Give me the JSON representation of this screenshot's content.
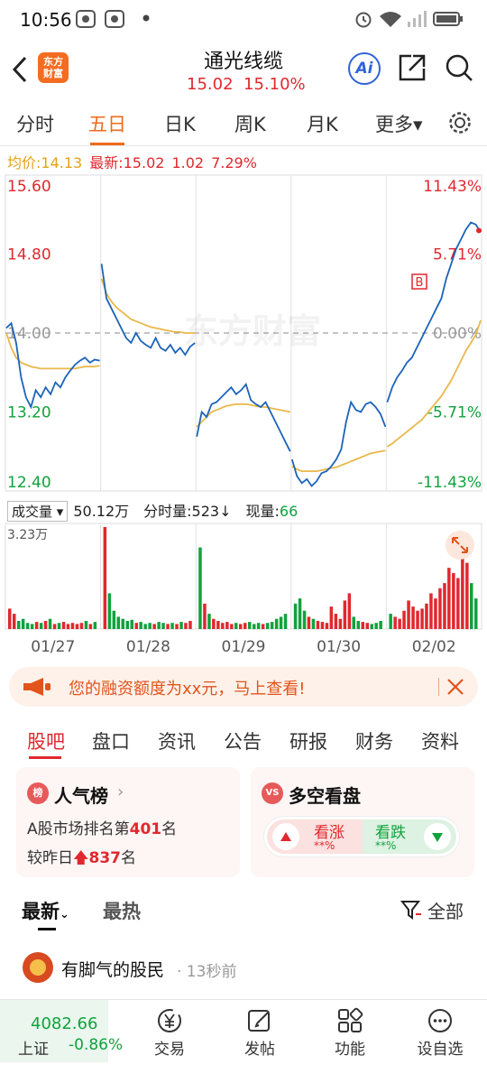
{
  "status": {
    "time": "10:56"
  },
  "header": {
    "logo_text_1": "东方",
    "logo_text_2": "财富",
    "title": "通光线缆",
    "price": "15.02",
    "change_pct": "15.10%",
    "ai_label": "Ai"
  },
  "period_tabs": [
    "分时",
    "五日",
    "日K",
    "周K",
    "月K",
    "更多▾"
  ],
  "avg_line": {
    "avg_label": "均价:",
    "avg_value": "14.13",
    "latest_label": "最新:",
    "latest_value": "15.02",
    "change": "1.02",
    "pct": "7.29%"
  },
  "colors": {
    "up": "#e0282e",
    "down": "#11a23c",
    "avg": "#e9b84a",
    "price": "#1c63b8",
    "accent": "#f06a1b"
  },
  "chart_data": {
    "type": "line",
    "price_axis": [
      "15.60",
      "14.80",
      "14.00",
      "13.20",
      "12.40"
    ],
    "pct_axis": [
      "11.43%",
      "5.71%",
      "0.00%",
      "-5.71%",
      "-11.43%"
    ],
    "days": [
      "01/27",
      "01/28",
      "01/29",
      "01/30",
      "02/02"
    ],
    "ylim": [
      12.4,
      15.6
    ],
    "prev_close": 14.0,
    "watermark": "东方财富",
    "price_series": [
      [
        14.05,
        14.1,
        13.9,
        13.55,
        13.35,
        13.25,
        13.42,
        13.35,
        13.45,
        13.38,
        13.5,
        13.45,
        13.55,
        13.62,
        13.68,
        13.72,
        13.75,
        13.7,
        13.73,
        13.72
      ],
      [
        14.7,
        14.35,
        14.25,
        14.15,
        14.05,
        13.95,
        13.9,
        14.0,
        13.92,
        13.88,
        13.85,
        13.95,
        13.85,
        13.82,
        13.88,
        13.8,
        13.85,
        13.78,
        13.86,
        13.9
      ],
      [
        12.95,
        13.2,
        13.15,
        13.28,
        13.3,
        13.35,
        13.4,
        13.45,
        13.38,
        13.42,
        13.48,
        13.32,
        13.28,
        13.25,
        13.3,
        13.2,
        13.1,
        13.0,
        12.9,
        12.8
      ],
      [
        12.72,
        12.55,
        12.48,
        12.52,
        12.45,
        12.5,
        12.58,
        12.6,
        12.65,
        12.72,
        12.82,
        13.1,
        13.3,
        13.22,
        13.2,
        13.28,
        13.3,
        13.25,
        13.18,
        13.05
      ],
      [
        13.3,
        13.45,
        13.55,
        13.62,
        13.7,
        13.75,
        13.85,
        13.95,
        14.05,
        14.15,
        14.25,
        14.35,
        14.55,
        14.7,
        14.85,
        14.95,
        15.05,
        15.12,
        15.1,
        15.02
      ]
    ],
    "avg_series": [
      [
        14.0,
        13.85,
        13.75,
        13.7,
        13.68,
        13.66,
        13.65,
        13.64,
        13.64,
        13.64,
        13.64,
        13.64,
        13.64,
        13.64,
        13.64,
        13.65,
        13.66,
        13.66,
        13.66,
        13.67
      ],
      [
        14.55,
        14.4,
        14.32,
        14.26,
        14.22,
        14.18,
        14.14,
        14.12,
        14.1,
        14.08,
        14.06,
        14.05,
        14.04,
        14.03,
        14.02,
        14.01,
        14.01,
        14.0,
        14.0,
        14.0
      ],
      [
        13.05,
        13.1,
        13.15,
        13.2,
        13.22,
        13.24,
        13.26,
        13.27,
        13.28,
        13.28,
        13.28,
        13.27,
        13.26,
        13.25,
        13.25,
        13.24,
        13.23,
        13.22,
        13.21,
        13.2
      ],
      [
        12.65,
        12.62,
        12.6,
        12.6,
        12.6,
        12.6,
        12.61,
        12.62,
        12.63,
        12.64,
        12.66,
        12.68,
        12.7,
        12.72,
        12.74,
        12.76,
        12.78,
        12.79,
        12.8,
        12.81
      ],
      [
        12.85,
        12.88,
        12.92,
        12.96,
        13.0,
        13.04,
        13.08,
        13.12,
        13.18,
        13.24,
        13.3,
        13.36,
        13.44,
        13.52,
        13.62,
        13.72,
        13.82,
        13.9,
        13.98,
        14.13
      ]
    ],
    "volume_max_label": "3.23万",
    "volume_series": [
      [
        0.2,
        0.15,
        0.08,
        0.1,
        0.06,
        0.05,
        0.07,
        0.06,
        0.08,
        0.1,
        0.05,
        0.06,
        0.07,
        0.05,
        0.06,
        0.05,
        0.06,
        0.08,
        0.05,
        0.07
      ],
      [
        1.0,
        0.35,
        0.18,
        0.12,
        0.1,
        0.08,
        0.09,
        0.06,
        0.07,
        0.05,
        0.06,
        0.05,
        0.07,
        0.06,
        0.05,
        0.06,
        0.05,
        0.07,
        0.06,
        0.08
      ],
      [
        0.8,
        0.25,
        0.15,
        0.1,
        0.08,
        0.06,
        0.07,
        0.05,
        0.06,
        0.05,
        0.06,
        0.07,
        0.05,
        0.06,
        0.05,
        0.06,
        0.07,
        0.1,
        0.12,
        0.15
      ],
      [
        0.25,
        0.3,
        0.18,
        0.12,
        0.1,
        0.08,
        0.07,
        0.06,
        0.22,
        0.15,
        0.1,
        0.28,
        0.35,
        0.12,
        0.08,
        0.07,
        0.06,
        0.05,
        0.06,
        0.08
      ],
      [
        0.15,
        0.12,
        0.1,
        0.18,
        0.28,
        0.22,
        0.18,
        0.2,
        0.25,
        0.35,
        0.3,
        0.4,
        0.45,
        0.6,
        0.55,
        0.5,
        0.7,
        0.65,
        0.45,
        0.3
      ]
    ]
  },
  "volume_header": {
    "select_label": "成交量",
    "total": "50.12万",
    "tick_label": "分时量:",
    "tick_value": "523",
    "tick_arrow": "↓",
    "now_label": "现量:",
    "now_value": "66"
  },
  "marker_label": "B",
  "banner": {
    "text": "您的融资额度为xx元，马上查看!"
  },
  "section_tabs": [
    "股吧",
    "盘口",
    "资讯",
    "公告",
    "研报",
    "财务",
    "资料"
  ],
  "popularity": {
    "icon_label": "榜",
    "title": "人气榜",
    "line1_prefix": "A股市场排名第",
    "rank": "401",
    "line1_suffix": "名",
    "line2_prefix": "较昨日",
    "rank_change": "837",
    "line2_suffix": "名"
  },
  "sentiment": {
    "icon_label": "VS",
    "title": "多空看盘",
    "bull_label": "看涨",
    "bull_value": "**%",
    "bear_label": "看跌",
    "bear_value": "**%"
  },
  "feed_tabs": {
    "latest": "最新",
    "hot": "最热",
    "filter": "全部"
  },
  "post": {
    "user": "有脚气的股民",
    "time": "· 13秒前"
  },
  "bottom_bar": {
    "index_value": "4082.66",
    "index_name": "上证",
    "index_change": "-0.86%",
    "items": [
      "交易",
      "发帖",
      "功能",
      "设自选"
    ]
  }
}
